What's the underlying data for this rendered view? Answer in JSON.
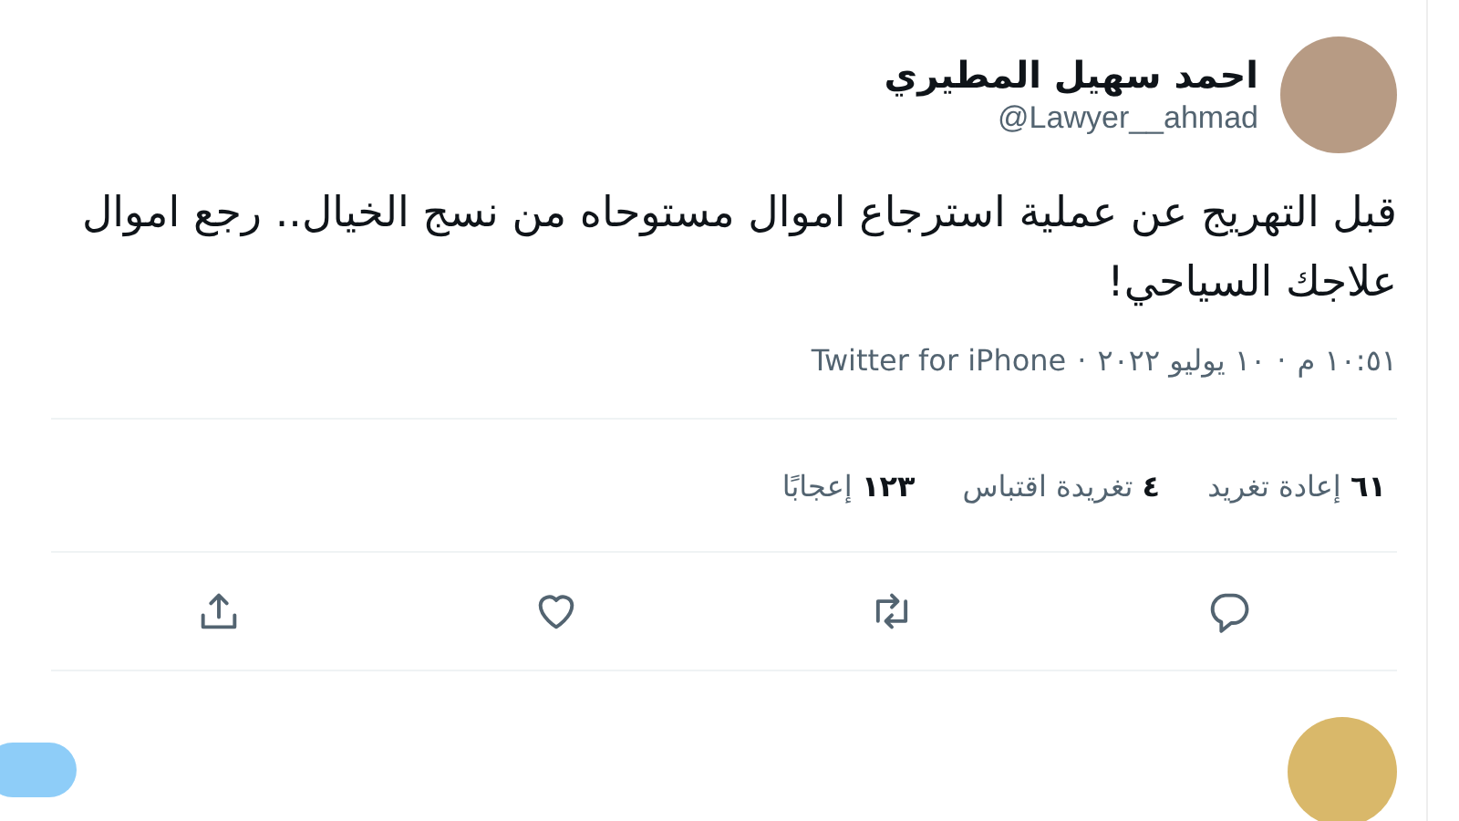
{
  "author": {
    "name": "احمد سهيل المطيري",
    "handle": "@Lawyer__ahmad"
  },
  "tweet": {
    "text": "قبل التهريج عن عملية استرجاع اموال مستوحاه من نسج الخيال.. رجع اموال علاجك السياحي!"
  },
  "meta": [
    "١٠:٥١ م",
    "·",
    "١٠ يوليو ٢٠٢٢",
    "·",
    "Twitter for iPhone"
  ],
  "stats": [
    {
      "count": "٦١",
      "label": "إعادة تغريد"
    },
    {
      "count": "٤",
      "label": "تغريدة اقتباس"
    },
    {
      "count": "١٢٣",
      "label": "إعجابًا"
    }
  ]
}
